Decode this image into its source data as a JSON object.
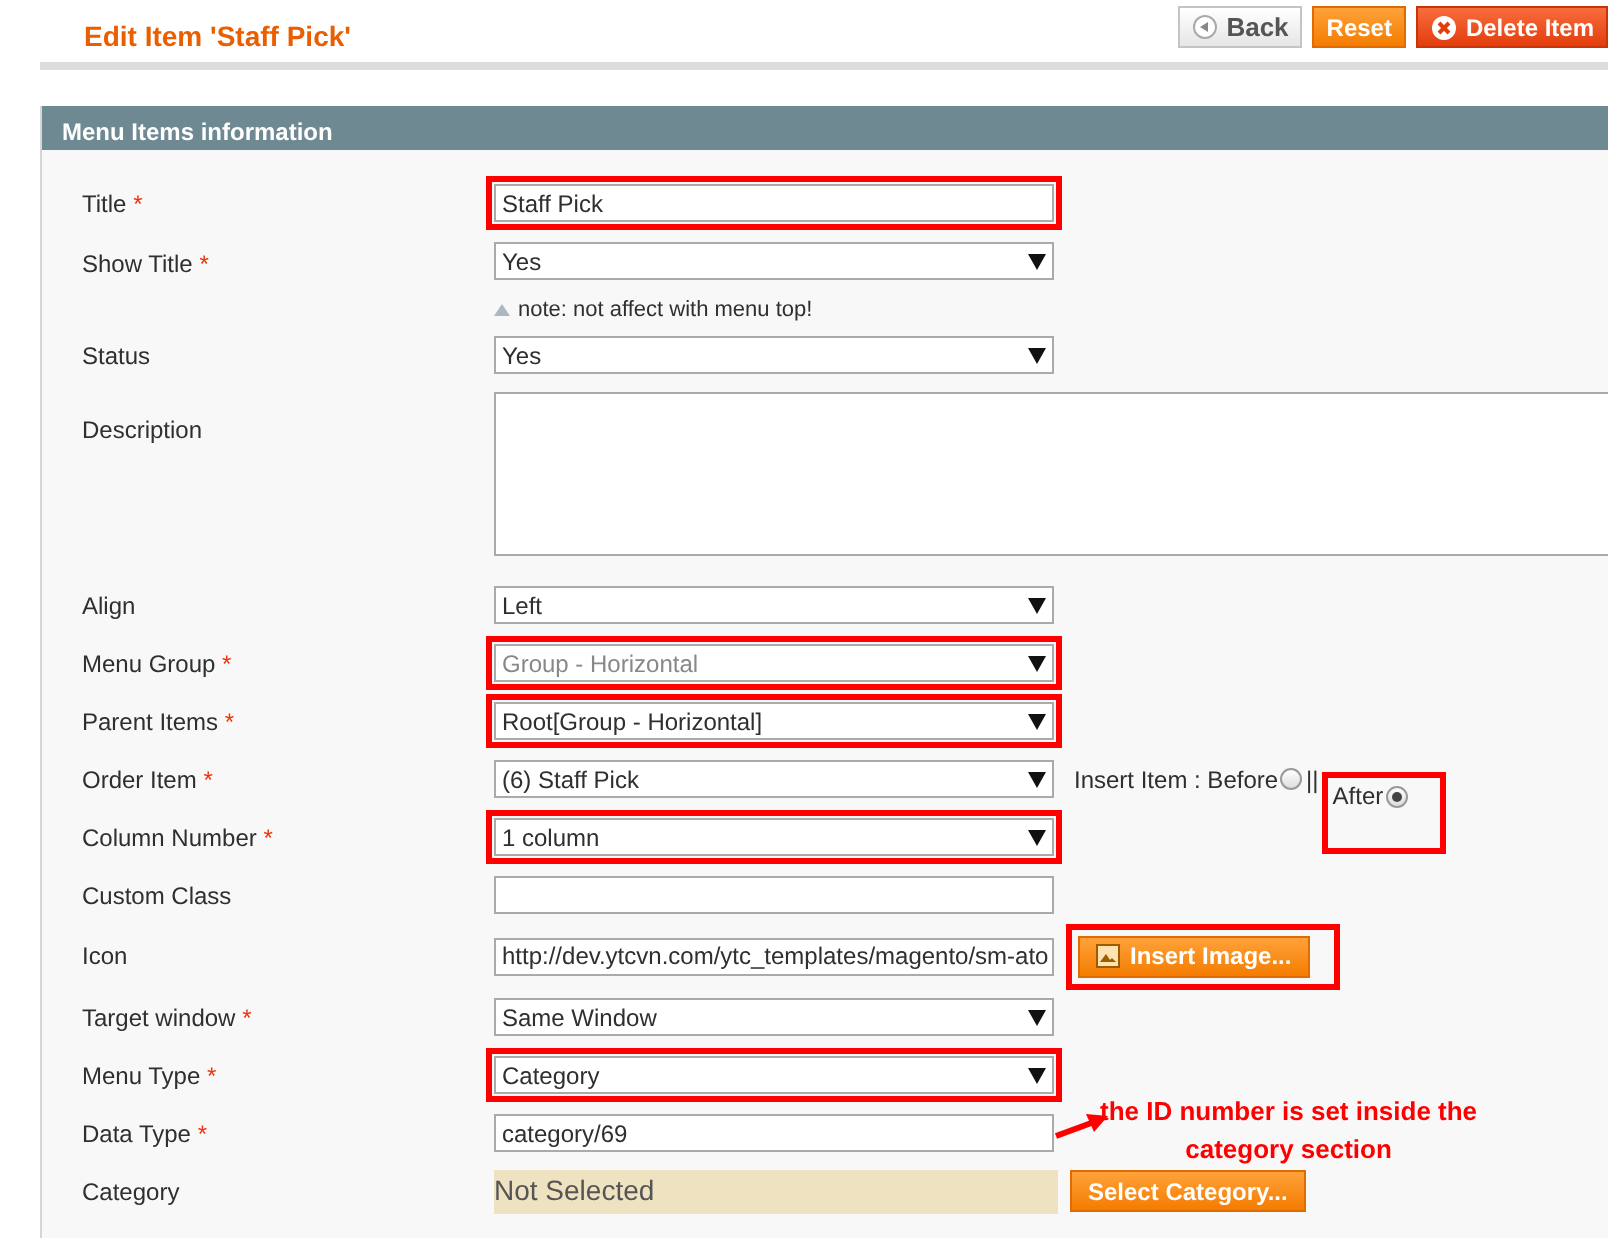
{
  "page_title": "Edit Item 'Staff Pick'",
  "buttons": [
    {
      "label": "Back",
      "kind": "back"
    },
    {
      "label": "Reset",
      "kind": "reset"
    },
    {
      "label": "Delete Item",
      "kind": "delete"
    }
  ],
  "section": {
    "title": "Menu Items information"
  },
  "rows": [
    {
      "label": "Title",
      "required_mark": "*",
      "kind": "text",
      "value": "Staff Pick",
      "highlighted": true
    },
    {
      "label": "Show Title",
      "required_mark": "*",
      "kind": "select",
      "value": "Yes",
      "highlighted": false,
      "disabled": false,
      "note": "note: not affect with menu top!"
    },
    {
      "label": "Status",
      "kind": "select",
      "value": "Yes",
      "highlighted": false,
      "disabled": false
    },
    {
      "label": "Description",
      "kind": "textarea"
    },
    {
      "label": "Align",
      "kind": "select",
      "value": "Left",
      "highlighted": false,
      "disabled": false
    },
    {
      "label": "Menu Group",
      "required_mark": "*",
      "kind": "select",
      "value": "Group - Horizontal",
      "highlighted": true,
      "disabled": true
    },
    {
      "label": "Parent Items",
      "required_mark": "*",
      "kind": "select",
      "value": "Root[Group - Horizontal]",
      "highlighted": true,
      "disabled": false
    },
    {
      "label": "Order Item",
      "required_mark": "*",
      "kind": "order",
      "value": "(6) Staff Pick",
      "highlighted": false,
      "disabled": false,
      "separator": "||",
      "options": [
        {
          "label": "Insert Item : Before",
          "selected": false,
          "highlighted": false
        },
        {
          "label": "After",
          "selected": true,
          "highlighted": true
        }
      ]
    },
    {
      "label": "Column Number",
      "required_mark": "*",
      "kind": "select",
      "value": "1 column",
      "highlighted": true,
      "disabled": false
    },
    {
      "label": "Custom Class",
      "kind": "text",
      "value": "",
      "highlighted": false
    },
    {
      "label": "Icon",
      "kind": "image",
      "value": "http://dev.ytcvn.com/ytc_templates/magento/sm-ato",
      "highlighted": false,
      "button": {
        "label": "Insert Image...",
        "highlighted": true
      }
    },
    {
      "label": "Target window",
      "required_mark": "*",
      "kind": "select",
      "value": "Same Window",
      "highlighted": false,
      "disabled": false
    },
    {
      "label": "Menu Type",
      "required_mark": "*",
      "kind": "select",
      "value": "Category",
      "highlighted": true,
      "disabled": false
    },
    {
      "label": "Data Type",
      "required_mark": "*",
      "kind": "text",
      "value": "category/69",
      "highlighted": false
    },
    {
      "label": "Category",
      "kind": "category",
      "value": "Not Selected",
      "button": {
        "label": "Select Category...",
        "highlighted": false
      }
    }
  ],
  "annotation": {
    "lines": [
      "the  ID number is set inside the",
      "category section"
    ]
  }
}
